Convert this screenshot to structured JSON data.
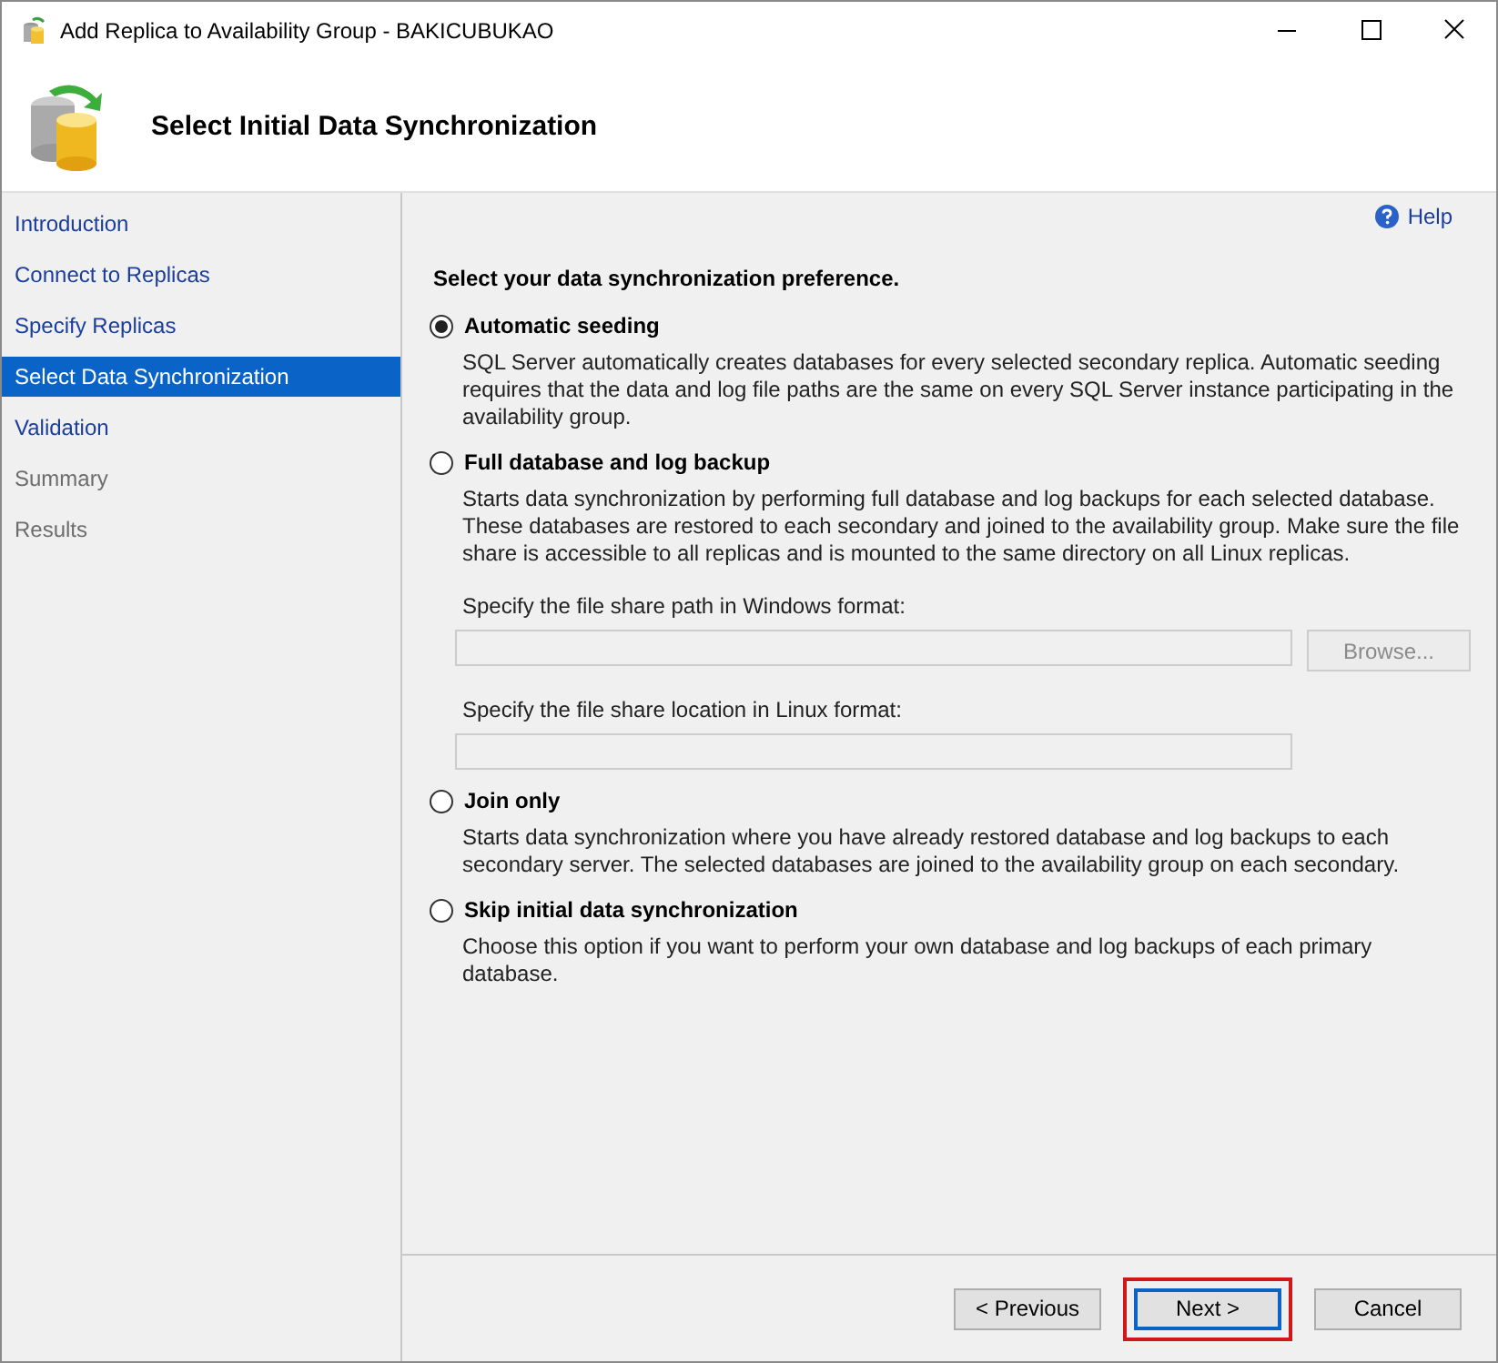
{
  "window": {
    "title": "Add Replica to Availability Group - BAKICUBUKAO"
  },
  "header": {
    "title": "Select Initial Data Synchronization"
  },
  "sidebar": {
    "items": [
      {
        "label": "Introduction",
        "selected": false,
        "disabled": false
      },
      {
        "label": "Connect to Replicas",
        "selected": false,
        "disabled": false
      },
      {
        "label": "Specify Replicas",
        "selected": false,
        "disabled": false
      },
      {
        "label": "Select Data Synchronization",
        "selected": true,
        "disabled": false
      },
      {
        "label": "Validation",
        "selected": false,
        "disabled": false
      },
      {
        "label": "Summary",
        "selected": false,
        "disabled": true
      },
      {
        "label": "Results",
        "selected": false,
        "disabled": true
      }
    ]
  },
  "help": {
    "label": "Help"
  },
  "prompt": "Select your data synchronization preference.",
  "options": [
    {
      "label": "Automatic seeding",
      "selected": true,
      "description": "SQL Server automatically creates databases for every selected secondary replica. Automatic seeding requires that the data and log file paths are the same on every SQL Server instance participating in the availability group."
    },
    {
      "label": "Full database and log backup",
      "selected": false,
      "description": "Starts data synchronization by performing full database and log backups for each selected database. These databases are restored to each secondary and joined to the availability group. Make sure the file share is accessible to all replicas and is mounted to the same directory on all Linux replicas.",
      "fields": [
        {
          "label": "Specify the file share path in Windows format:",
          "disabled": true,
          "button": "Browse..."
        },
        {
          "label": "Specify the file share location in Linux format:",
          "disabled": true
        }
      ]
    },
    {
      "label": "Join only",
      "selected": false,
      "description": "Starts data synchronization where you have already restored database and log backups to each secondary server. The selected databases are joined to the availability group on each secondary."
    },
    {
      "label": "Skip initial data synchronization",
      "selected": false,
      "description": "Choose this option if you want to perform your own database and log backups of each primary database."
    }
  ],
  "buttons": [
    {
      "label": "< Previous",
      "focused": false,
      "highlighted": false
    },
    {
      "label": "Next >",
      "focused": true,
      "highlighted": true
    },
    {
      "label": "Cancel",
      "focused": false,
      "highlighted": false
    }
  ]
}
